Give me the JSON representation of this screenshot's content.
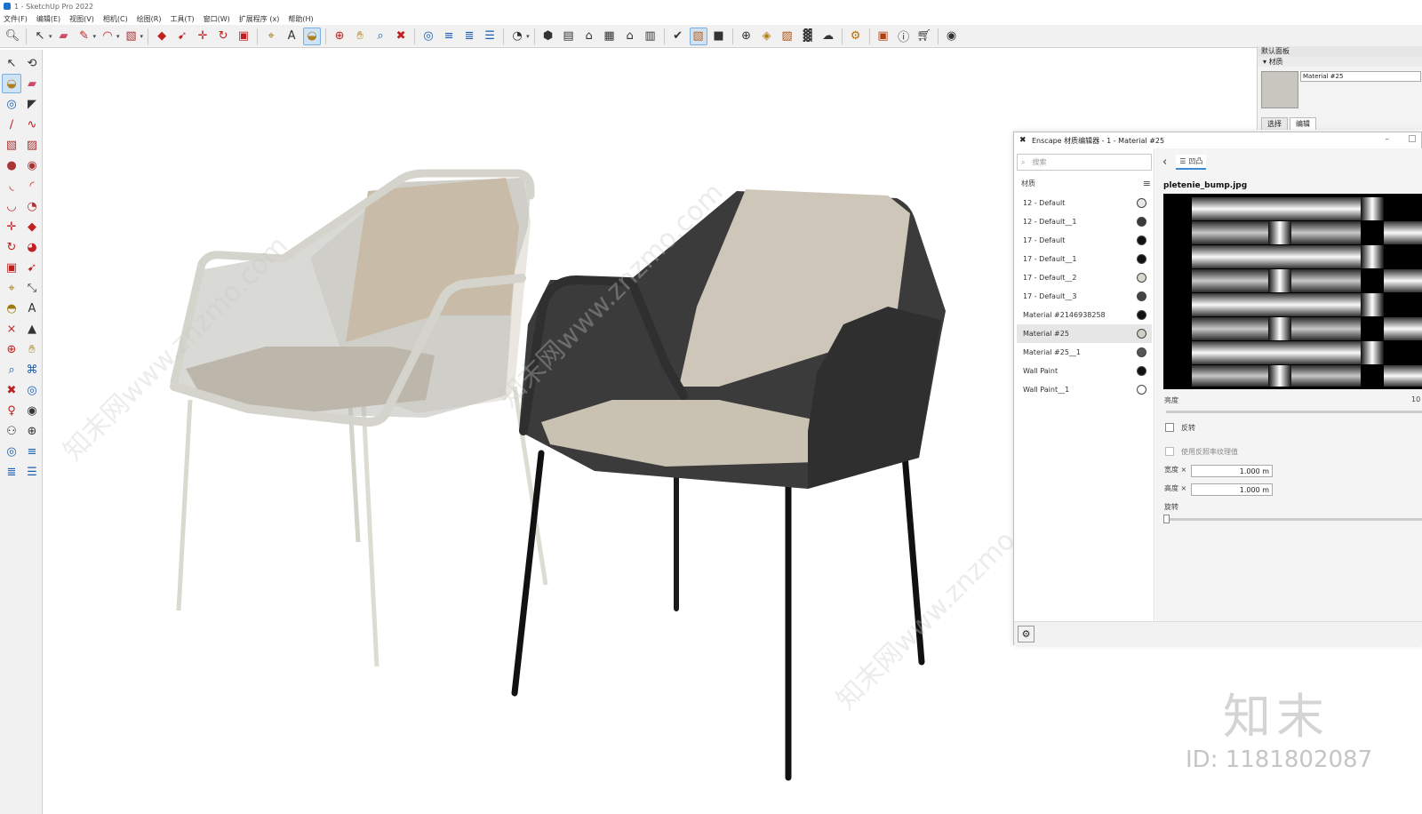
{
  "window": {
    "title": "1 - SketchUp Pro 2022"
  },
  "menu": [
    "文件(F)",
    "编辑(E)",
    "视图(V)",
    "相机(C)",
    "绘图(R)",
    "工具(T)",
    "窗口(W)",
    "扩展程序 (x)",
    "帮助(H)"
  ],
  "tray": {
    "title": "默认面板",
    "section": "材质",
    "material_name": "Material #25",
    "tabs": [
      "选择",
      "编辑"
    ]
  },
  "enscape": {
    "title": "Enscape 材质编辑器 - 1 - Material #25",
    "search_placeholder": "搜索",
    "list_header": "材质",
    "materials": [
      {
        "name": "12 - Default",
        "dot": "#e8e8e8"
      },
      {
        "name": "12 - Default__1",
        "dot": "#3a3a3a"
      },
      {
        "name": "17 - Default",
        "dot": "#111111"
      },
      {
        "name": "17 - Default__1",
        "dot": "#111111"
      },
      {
        "name": "17 - Default__2",
        "dot": "#d8d8d0"
      },
      {
        "name": "17 - Default__3",
        "dot": "#444444"
      },
      {
        "name": "Material #2146938258",
        "dot": "#111111"
      },
      {
        "name": "Material #25",
        "dot": "#cfcdc5"
      },
      {
        "name": "Material #25__1",
        "dot": "#555555"
      },
      {
        "name": "Wall Paint",
        "dot": "#111111"
      },
      {
        "name": "Wall Paint__1",
        "dot": "#ffffff"
      }
    ],
    "selected_material": "Material #25",
    "tab_label": "凹凸",
    "texture_name": "pletenie_bump.jpg",
    "brightness_label": "亮度",
    "brightness_value": "10",
    "invert_label": "反转",
    "use_reflect_label": "使用反照率纹理值",
    "width_label": "宽度 ×",
    "width_value": "1.000 m",
    "height_label": "高度 ×",
    "height_value": "1.000 m",
    "rotation_label": "旋转"
  },
  "watermark": {
    "logo": "知末",
    "id": "ID: 1181802087",
    "diag": "知末网www.znzmo.com"
  }
}
